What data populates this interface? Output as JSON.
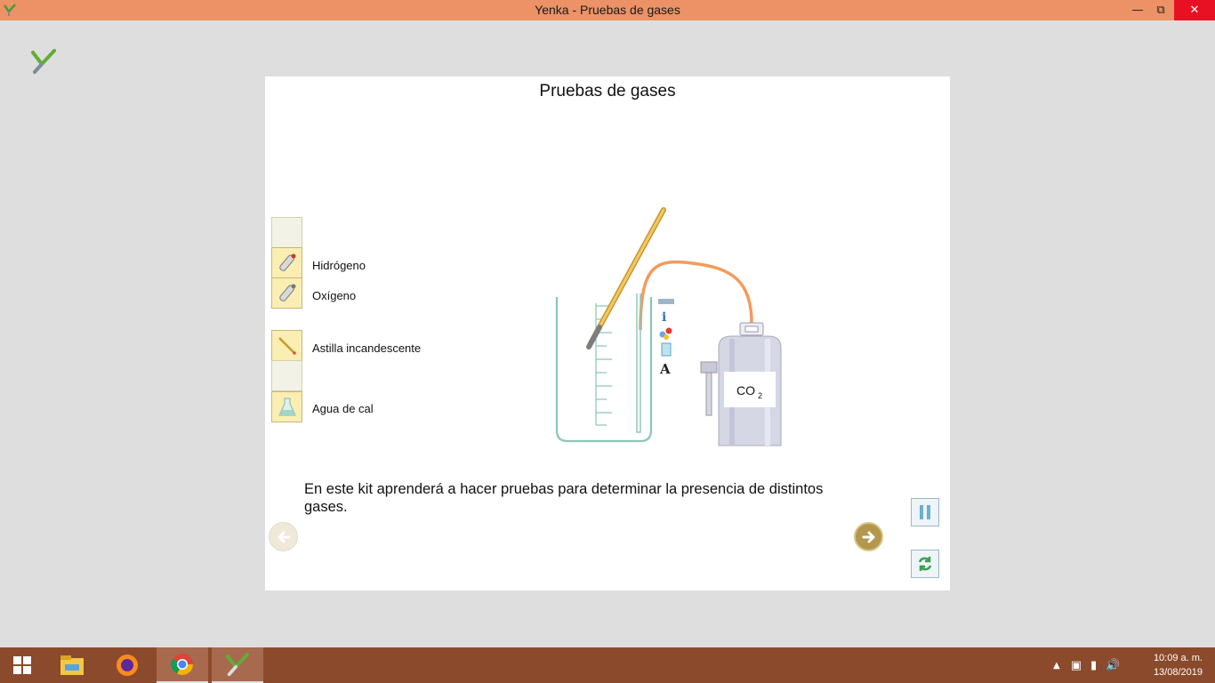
{
  "window": {
    "title": "Yenka - Pruebas de gases",
    "minimize_icon": "minimize-icon",
    "restore_icon": "restore-icon",
    "close_icon": "close-icon"
  },
  "panel": {
    "title": "Pruebas de gases",
    "items": [
      {
        "label": "",
        "icon": "empty-slot"
      },
      {
        "label": "Hidrógeno",
        "icon": "hydrogen-cylinder-icon"
      },
      {
        "label": "Oxígeno",
        "icon": "oxygen-cylinder-icon"
      },
      {
        "label": "Astilla incandescente",
        "icon": "splint-icon"
      },
      {
        "label": "",
        "icon": "empty-slot"
      },
      {
        "label": "Agua de cal",
        "icon": "flask-icon"
      }
    ],
    "cylinder_label": "CO",
    "cylinder_label_sub": "2",
    "description": "En este kit aprenderá a hacer pruebas para determinar la presencia de distintos gases."
  },
  "taskbar": {
    "time": "10:09 a. m.",
    "date": "13/08/2019"
  },
  "colors": {
    "titlebar": "#ec9266",
    "taskbar": "#8b4a2b",
    "tube": "#f59a5c",
    "beaker": "#8cc5b8"
  }
}
